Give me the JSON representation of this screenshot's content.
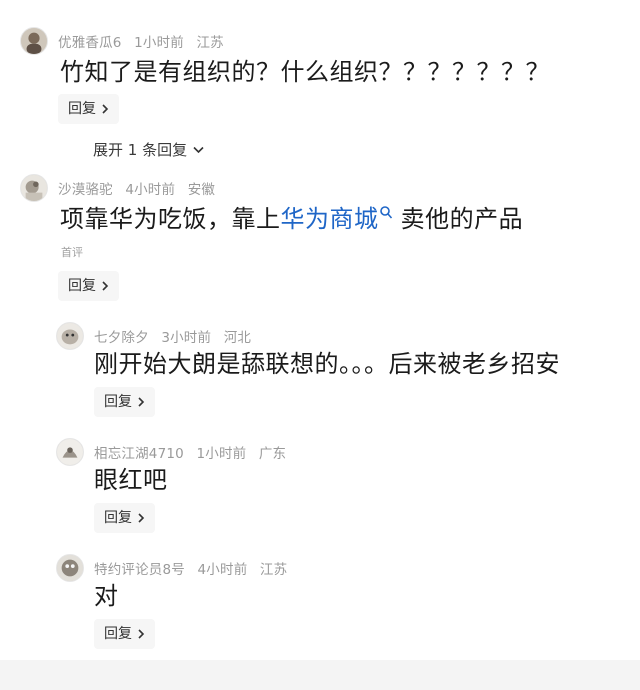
{
  "comments": [
    {
      "user": "优雅香瓜6",
      "time": "1小时前",
      "region": "江苏",
      "text": "竹知了是有组织的？什么组织？？？？？？？",
      "reply_label": "回复",
      "expand_label": "展开 1 条回复"
    },
    {
      "user": "沙漠骆驼",
      "time": "4小时前",
      "region": "安徽",
      "text_before": "项靠华为吃饭，靠上",
      "text_link": "华为商城",
      "text_after": " 卖他的产品",
      "note": "首评",
      "reply_label": "回复"
    }
  ],
  "replies": [
    {
      "user": "七夕除夕",
      "time": "3小时前",
      "region": "河北",
      "text": "刚开始大朗是舔联想的。。。后来被老乡招安",
      "reply_label": "回复"
    },
    {
      "user": "相忘江湖4710",
      "time": "1小时前",
      "region": "广东",
      "text": "眼红吧",
      "reply_label": "回复"
    },
    {
      "user": "特约评论员8号",
      "time": "4小时前",
      "region": "江苏",
      "text": "对",
      "reply_label": "回复"
    }
  ],
  "icons": {
    "reply_chevron": "chevron-right-icon",
    "expand_chevron": "chevron-down-icon",
    "search_mark": "search-icon"
  }
}
